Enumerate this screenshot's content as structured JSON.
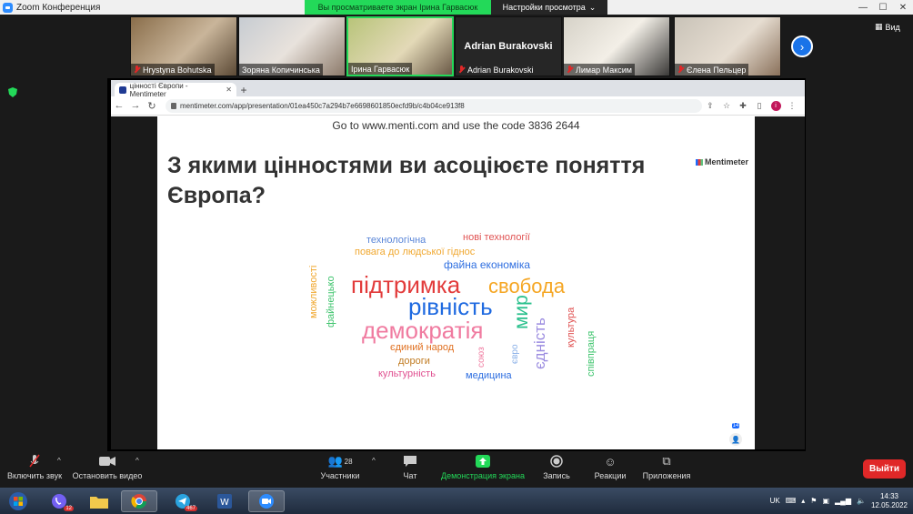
{
  "zoom": {
    "title": "Zoom Конференция",
    "share_banner": "Вы просматриваете экран Ірина Гарвасюк",
    "view_options": "Настройки просмотра"
  },
  "gallery": {
    "participants": [
      {
        "name": "Hrystyna Bohutska",
        "muted": true
      },
      {
        "name": "Зоряна Копичинська",
        "muted": false
      },
      {
        "name": "Ірина Гарвасюк",
        "muted": false
      },
      {
        "name": "Adrian Burakovski",
        "muted": true,
        "no_video": true
      },
      {
        "name": "Лимар Максим",
        "muted": true
      },
      {
        "name": "Єлена Пельцер",
        "muted": true
      }
    ],
    "view_label": "Вид"
  },
  "browser": {
    "tab_title": "цінності Європи - Mentimeter",
    "url": "mentimeter.com/app/presentation/01ea450c7a294b7e6698601850ecfd9b/c4b04ce913f8"
  },
  "slide": {
    "code_line": "Go to www.menti.com and use the code 3836 2644",
    "question": "З якими цінностями ви асоціюєте поняття Європа?",
    "logo": "Mentimeter",
    "response_count": "14",
    "words": [
      {
        "text": "технологічна",
        "color": "#5a86d8"
      },
      {
        "text": "нові технології",
        "color": "#e05252"
      },
      {
        "text": "повага до людської гіднос",
        "color": "#f0a830"
      },
      {
        "text": "файна економіка",
        "color": "#2f6fe0"
      },
      {
        "text": "підтримка",
        "color": "#e23b3b"
      },
      {
        "text": "свобода",
        "color": "#f5a623"
      },
      {
        "text": "рівність",
        "color": "#1f6ae0"
      },
      {
        "text": "демократія",
        "color": "#f07ba0"
      },
      {
        "text": "мир",
        "color": "#29c08c"
      },
      {
        "text": "єдність",
        "color": "#9b8ce0"
      },
      {
        "text": "можливості",
        "color": "#f0a830"
      },
      {
        "text": "файнецько",
        "color": "#3ec46d"
      },
      {
        "text": "культура",
        "color": "#e05252"
      },
      {
        "text": "співпраця",
        "color": "#3ec46d"
      },
      {
        "text": "єдиний народ",
        "color": "#e07020"
      },
      {
        "text": "дороги",
        "color": "#c07a20"
      },
      {
        "text": "культурність",
        "color": "#e05090"
      },
      {
        "text": "союз",
        "color": "#f07ba0"
      },
      {
        "text": "євро",
        "color": "#8ab0e8"
      },
      {
        "text": "медицина",
        "color": "#2f6fe0"
      }
    ]
  },
  "toolbar": {
    "mute": "Включить звук",
    "video": "Остановить видео",
    "participants": "Участники",
    "participants_count": "28",
    "chat": "Чат",
    "share": "Демонстрация экрана",
    "record": "Запись",
    "reactions": "Реакции",
    "apps": "Приложения",
    "leave": "Выйти"
  },
  "taskbar": {
    "viber_badge": "12",
    "telegram_badge": "467",
    "lang": "UK",
    "time": "14:33",
    "date": "12.05.2022"
  }
}
